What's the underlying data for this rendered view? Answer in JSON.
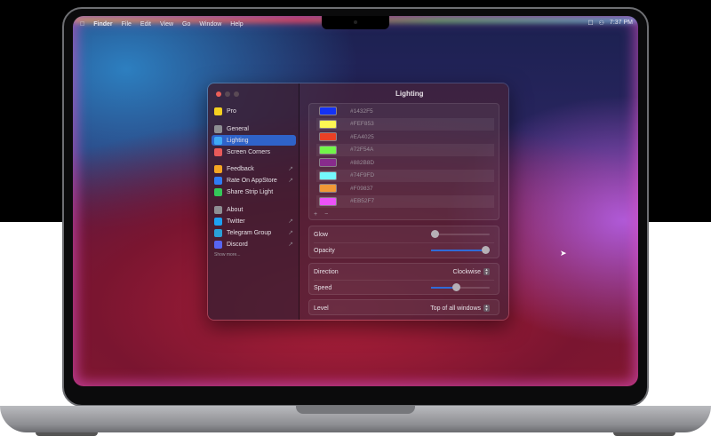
{
  "menubar": {
    "items": [
      "Finder",
      "File",
      "Edit",
      "View",
      "Go",
      "Window",
      "Help"
    ],
    "time": "7:37 PM"
  },
  "window": {
    "title": "Lighting"
  },
  "sidebar": {
    "items": [
      {
        "label": "Pro",
        "color": "#f5d020"
      },
      {
        "label": "General",
        "color": "#8e8e93"
      },
      {
        "label": "Lighting",
        "color": "#3fa9f5",
        "selected": true
      },
      {
        "label": "Screen Corners",
        "color": "#e85a5a"
      },
      {
        "label": "Feedback",
        "color": "#f5a623",
        "external": true
      },
      {
        "label": "Rate On AppStore",
        "color": "#2f7cf6",
        "external": true
      },
      {
        "label": "Share Strip Light",
        "color": "#34c759"
      },
      {
        "label": "About",
        "color": "#8e8e93"
      },
      {
        "label": "Twitter",
        "color": "#1da1f2",
        "external": true
      },
      {
        "label": "Telegram Group",
        "color": "#2aa0d8",
        "external": true
      },
      {
        "label": "Discord",
        "color": "#5865f2",
        "external": true
      }
    ],
    "show_more": "Show more...",
    "external_icon": "↗"
  },
  "colors": [
    "#1432F5",
    "#FEF853",
    "#EA4025",
    "#72F54A",
    "#882B8D",
    "#74F9FD",
    "#F09837",
    "#EB52F7"
  ],
  "colors_controls": {
    "add": "+",
    "remove": "−"
  },
  "settings": {
    "glow": {
      "label": "Glow",
      "value": 0.05
    },
    "opacity": {
      "label": "Opacity",
      "value": 1.0
    },
    "direction": {
      "label": "Direction",
      "value": "Clockwise"
    },
    "speed": {
      "label": "Speed",
      "value": 0.43
    },
    "level": {
      "label": "Level",
      "value": "Top of all windows"
    }
  }
}
